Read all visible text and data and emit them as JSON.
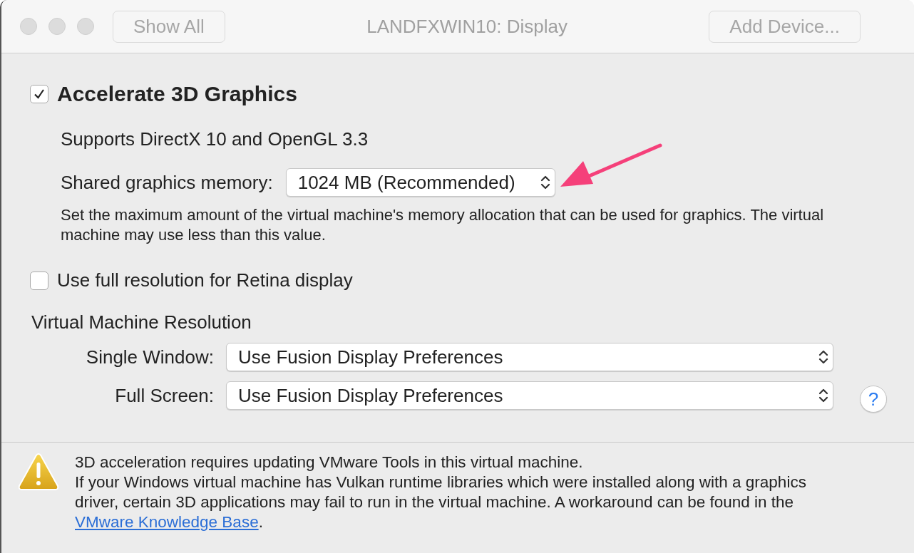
{
  "window": {
    "title": "LANDFXWIN10: Display"
  },
  "toolbar": [
    {
      "label": "Show All",
      "disabled": true
    },
    {
      "label": "Add Device...",
      "disabled": true
    }
  ],
  "accelerate": {
    "label": "Accelerate 3D Graphics",
    "checked": true
  },
  "support_text": "Supports DirectX 10 and OpenGL 3.3",
  "shared_memory": {
    "label": "Shared graphics memory:",
    "value": "1024 MB (Recommended)"
  },
  "memory_hint": "Set the maximum amount of the virtual machine's memory allocation that can be used for graphics. The virtual machine may use less than this value.",
  "retina": {
    "label": "Use full resolution for Retina display",
    "checked": false
  },
  "resolution": {
    "heading": "Virtual Machine Resolution",
    "rows": [
      {
        "label": "Single Window:",
        "value": "Use Fusion Display Preferences"
      },
      {
        "label": "Full Screen:",
        "value": "Use Fusion Display Preferences"
      }
    ]
  },
  "help_button": {
    "label": "?"
  },
  "warning": {
    "title": "3D acceleration requires updating VMware Tools in this virtual machine.",
    "text": "If your Windows virtual machine has Vulkan runtime libraries which were installed along with a graphics driver, certain 3D applications may fail to run in the virtual machine. A workaround can be found in the ",
    "link": "VMware Knowledge Base",
    "after": "."
  }
}
